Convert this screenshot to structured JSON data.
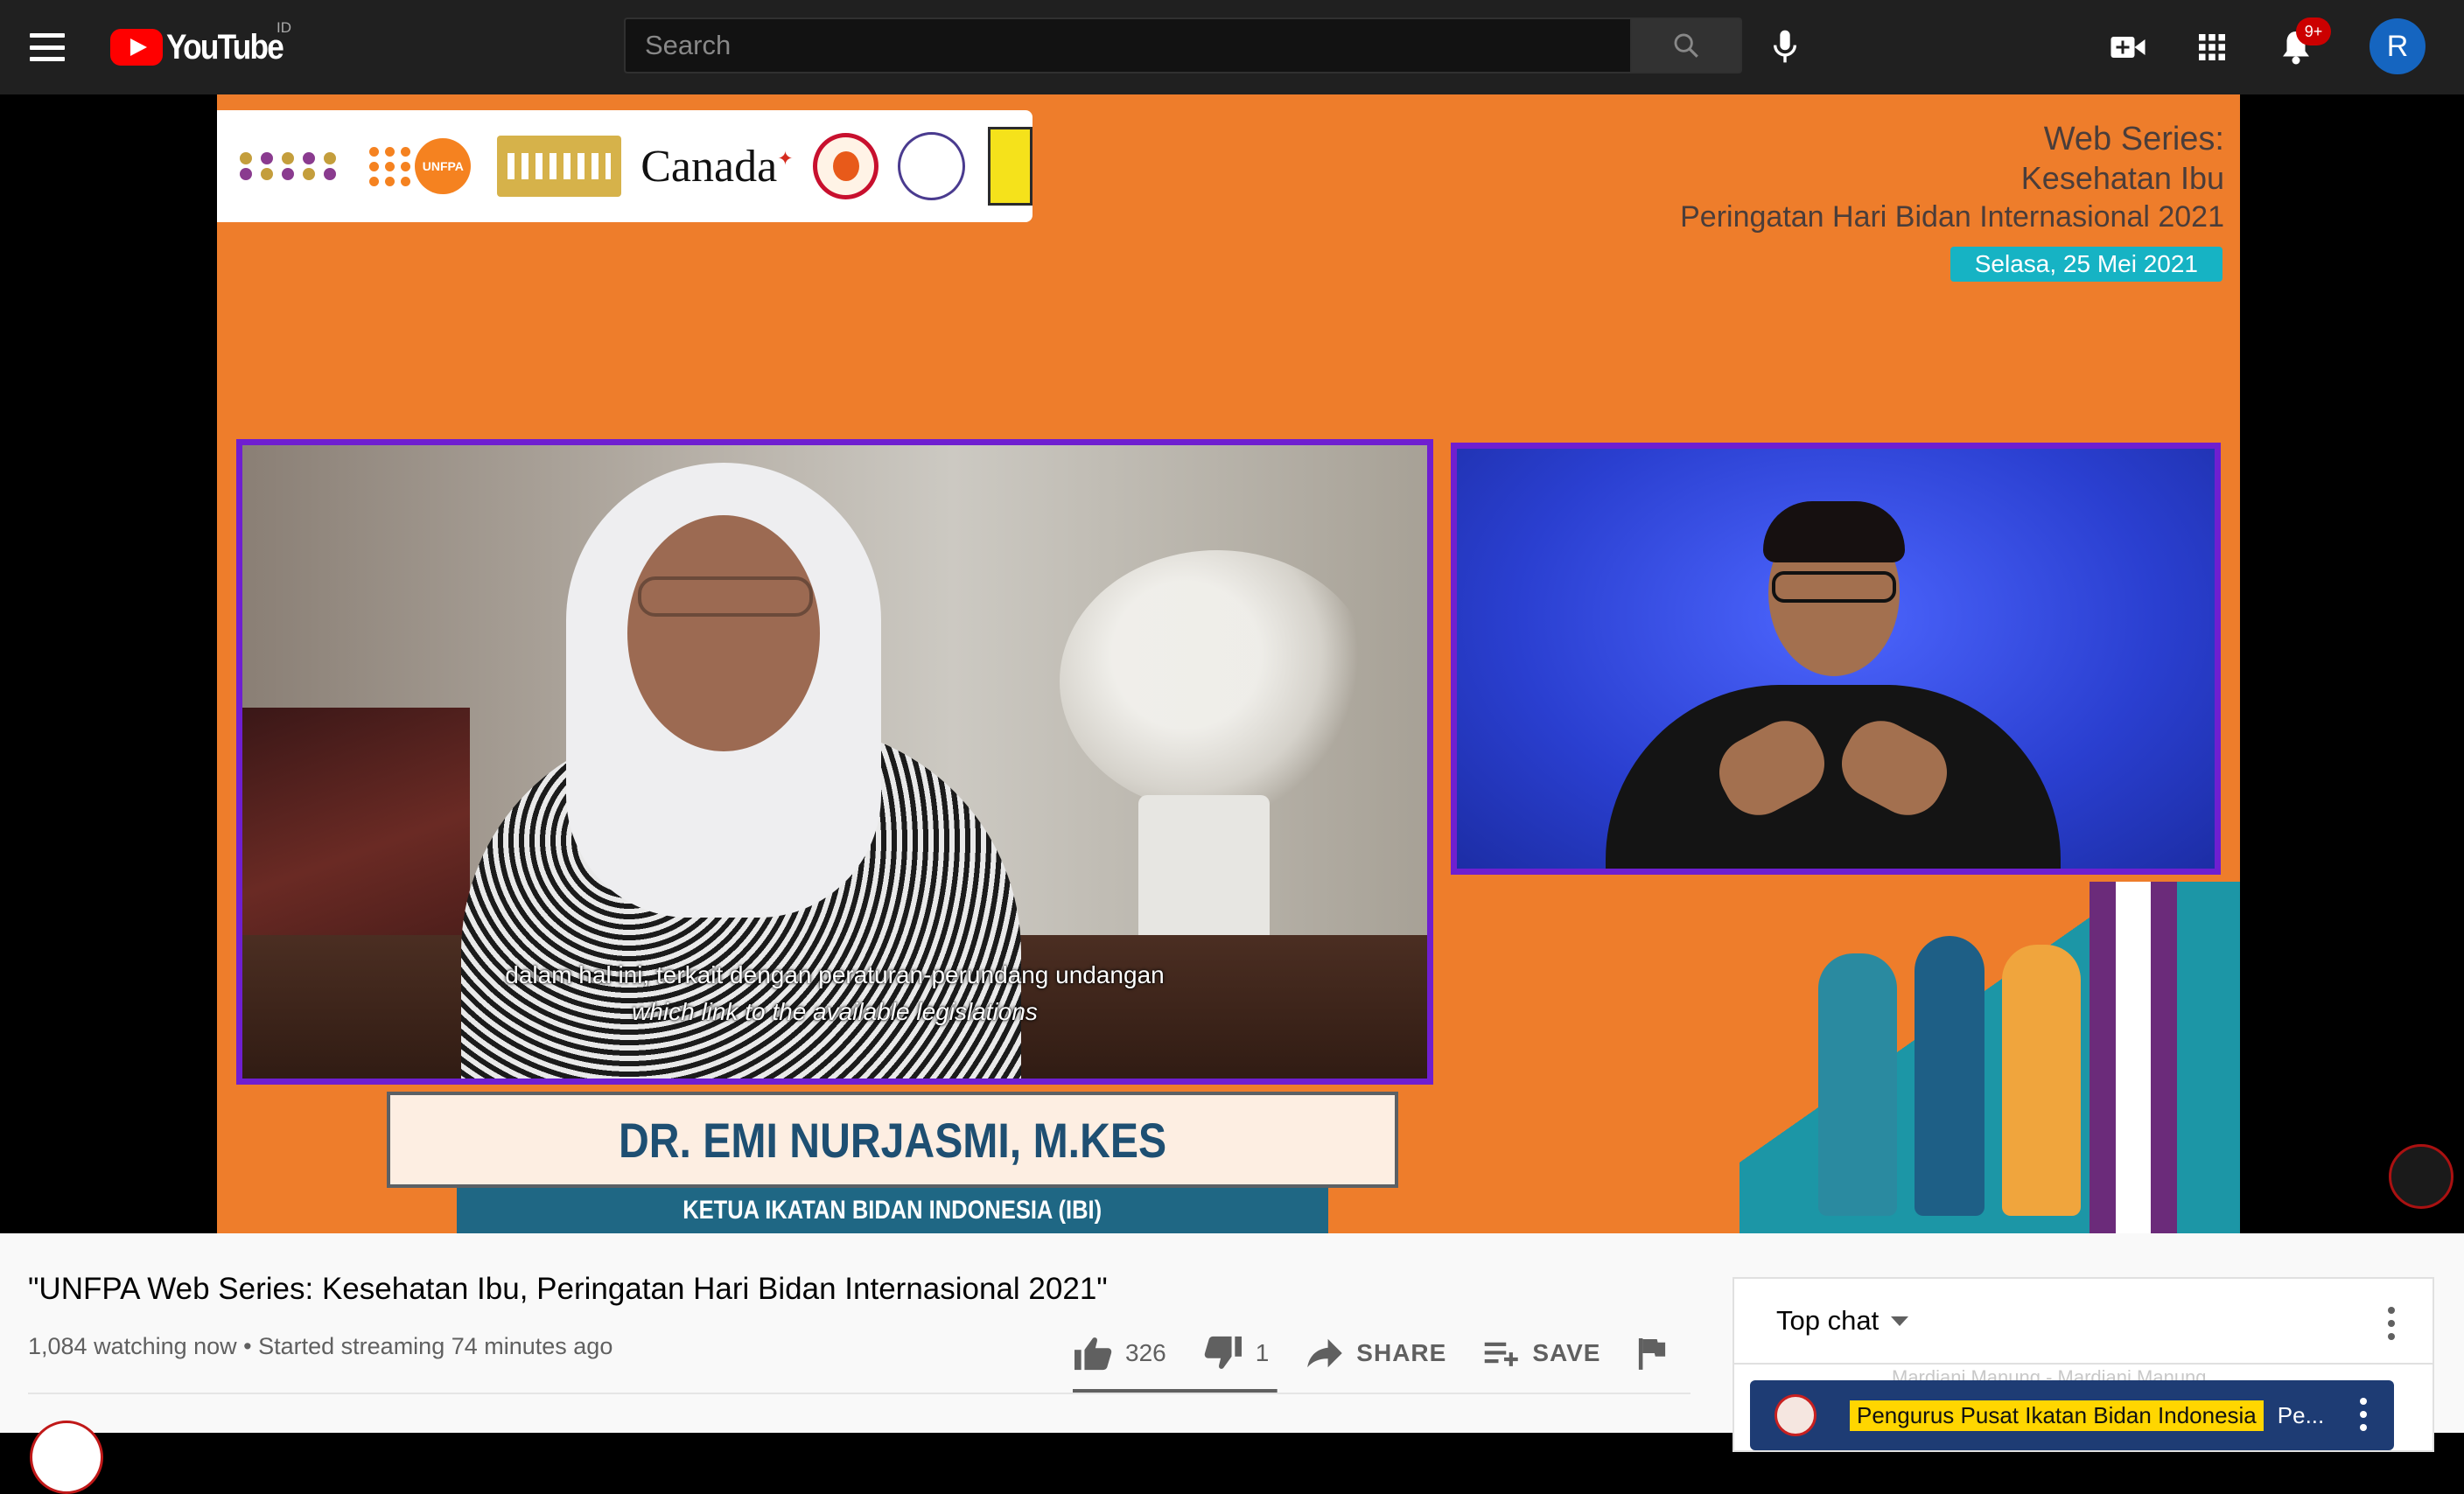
{
  "masthead": {
    "logo_text": "YouTube",
    "country_code": "ID",
    "search_placeholder": "Search",
    "notification_count": "9+",
    "avatar_initial": "R"
  },
  "video_frame": {
    "web_series_line1": "Web Series:",
    "web_series_line2": "Kesehatan Ibu",
    "web_series_line3": "Peringatan Hari Bidan Internasional 2021",
    "date": "Selasa, 25 Mei 2021",
    "sponsor_canada": "Canada",
    "sponsor_unfpa": "UNFPA",
    "subtitle_id": "dalam hal ini, terkait dengan peraturan-perundang undangan",
    "subtitle_en": "which link to the available legislations",
    "speaker_name": "DR. EMI NURJASMI, M.KES",
    "speaker_role": "KETUA IKATAN BIDAN INDONESIA (IBI)"
  },
  "video_info": {
    "title": "\"UNFPA Web Series: Kesehatan Ibu, Peringatan Hari Bidan Internasional 2021\"",
    "meta": "1,084 watching now • Started streaming 74 minutes ago",
    "likes": "326",
    "dislikes": "1",
    "share_label": "SHARE",
    "save_label": "SAVE",
    "like_ratio": 0.997
  },
  "chat": {
    "mode_label": "Top chat",
    "pinned_author": "Pengurus Pusat Ikatan Bidan Indonesia",
    "pinned_message": "Pe...",
    "ghost_text": "Mardiani Manung - Mardiani Manung"
  },
  "colors": {
    "youtube_red": "#ff0000",
    "masthead_bg": "#202020",
    "frame_orange": "#ee7d2b",
    "frame_purple": "#6f1fd0",
    "pinned_bg": "#1e3c74",
    "author_highlight": "#ffd600"
  },
  "icons": [
    "menu-icon",
    "search-icon",
    "mic-icon",
    "create-video-icon",
    "apps-icon",
    "bell-icon",
    "like-icon",
    "dislike-icon",
    "share-icon",
    "save-playlist-icon",
    "flag-icon",
    "more-vert-icon"
  ]
}
